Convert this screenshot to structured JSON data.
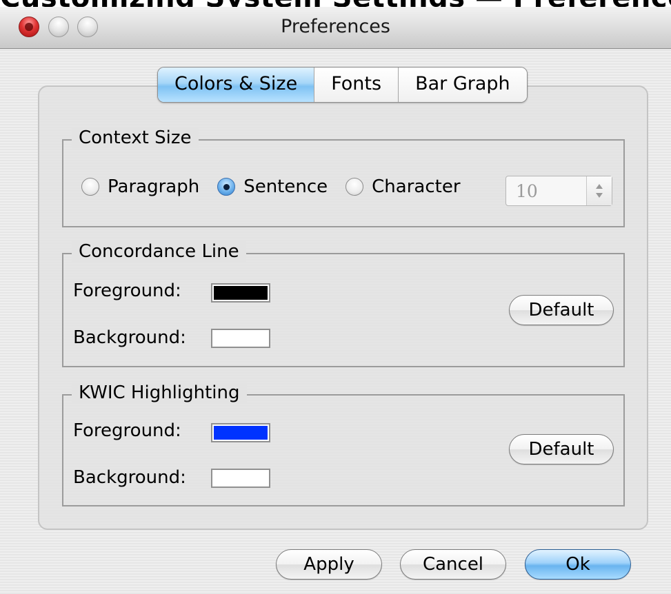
{
  "caption": "Customizing System Settings — Preferences",
  "window": {
    "title": "Preferences"
  },
  "tabs": [
    {
      "label": "Colors & Size",
      "active": true
    },
    {
      "label": "Fonts",
      "active": false
    },
    {
      "label": "Bar Graph",
      "active": false
    }
  ],
  "context_size": {
    "title": "Context Size",
    "options": [
      {
        "label": "Paragraph",
        "checked": false
      },
      {
        "label": "Sentence",
        "checked": true
      },
      {
        "label": "Character",
        "checked": false
      }
    ],
    "character_count": "10"
  },
  "concordance_line": {
    "title": "Concordance Line",
    "foreground_label": "Foreground:",
    "background_label": "Background:",
    "foreground_color": "#000000",
    "background_color": "#ffffff",
    "default_label": "Default"
  },
  "kwic_highlighting": {
    "title": "KWIC Highlighting",
    "foreground_label": "Foreground:",
    "background_label": "Background:",
    "foreground_color": "#0033ff",
    "background_color": "#ffffff",
    "default_label": "Default"
  },
  "buttons": {
    "apply": "Apply",
    "cancel": "Cancel",
    "ok": "Ok"
  }
}
